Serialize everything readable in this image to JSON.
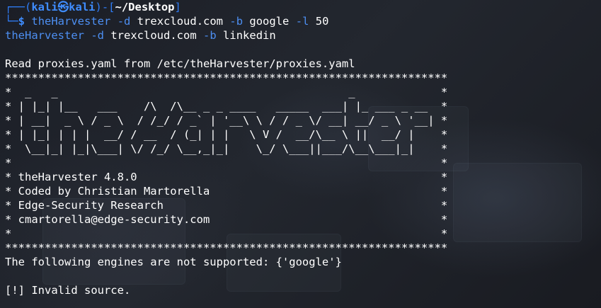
{
  "prompt": {
    "user": "kali",
    "at_symbol": "㉿",
    "host": "kali",
    "path": "~/Desktop",
    "dollar": "$"
  },
  "command1": {
    "program": "theHarvester",
    "flag_d": "-d",
    "domain": "trexcloud.com",
    "flag_b": "-b",
    "source": "google",
    "flag_l": "-l",
    "limit": "50"
  },
  "command2": {
    "program": "theHarvester",
    "flag_d": "-d",
    "domain": "trexcloud.com",
    "flag_b": "-b",
    "source": "linkedin"
  },
  "output": {
    "read_proxies": "Read proxies.yaml from /etc/theHarvester/proxies.yaml",
    "stars": "*******************************************************************",
    "banner_lines": [
      "*  _   _                                            _             *",
      "* | |_| |__   ___    /\\  /\\__ _ _ ____   _____  ___| |_ ___ _ __  *",
      "* | __|  _ \\ / _ \\  / /_/ / _` | '__\\ \\ / / _ \\/ __| __/ _ \\ '__| *",
      "* | |_| | | |  __/ / __  / (_| | |   \\ V /  __/\\__ \\ ||  __/ |    *",
      "*  \\__|_| |_|\\___| \\/ /_/ \\__,_|_|    \\_/ \\___||___/\\__\\___|_|    *",
      "*                                                                 *",
      "* theHarvester 4.8.0                                              *",
      "* Coded by Christian Martorella                                   *",
      "* Edge-Security Research                                          *",
      "* cmartorella@edge-security.com                                   *",
      "*                                                                 *"
    ],
    "engines_not_supported": "The following engines are not supported: {'google'}",
    "invalid_source": "[!] Invalid source."
  }
}
